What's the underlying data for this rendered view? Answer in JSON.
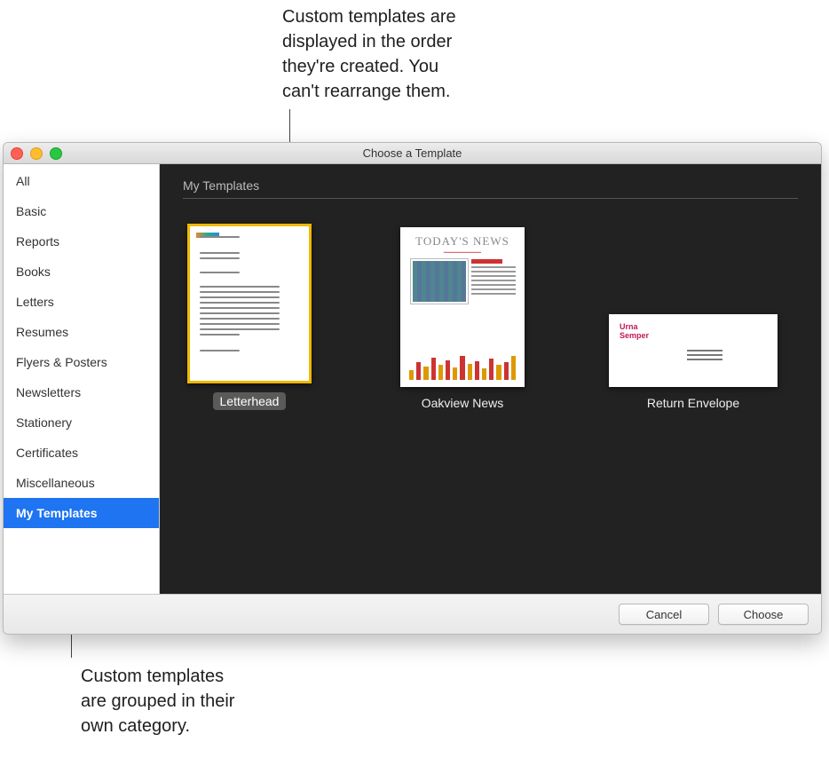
{
  "callouts": {
    "top": "Custom templates are\ndisplayed in the order\nthey're created. You\ncan't rearrange them.",
    "bottom": "Custom templates\nare grouped in their\nown category."
  },
  "window": {
    "title": "Choose a Template"
  },
  "sidebar": {
    "items": [
      {
        "label": "All",
        "selected": false
      },
      {
        "label": "Basic",
        "selected": false
      },
      {
        "label": "Reports",
        "selected": false
      },
      {
        "label": "Books",
        "selected": false
      },
      {
        "label": "Letters",
        "selected": false
      },
      {
        "label": "Resumes",
        "selected": false
      },
      {
        "label": "Flyers & Posters",
        "selected": false
      },
      {
        "label": "Newsletters",
        "selected": false
      },
      {
        "label": "Stationery",
        "selected": false
      },
      {
        "label": "Certificates",
        "selected": false
      },
      {
        "label": "Miscellaneous",
        "selected": false
      },
      {
        "label": "My Templates",
        "selected": true
      }
    ]
  },
  "content": {
    "section_title": "My Templates",
    "templates": [
      {
        "label": "Letterhead",
        "kind": "letter",
        "selected": true
      },
      {
        "label": "Oakview News",
        "kind": "news",
        "selected": false
      },
      {
        "label": "Return Envelope",
        "kind": "envelope",
        "selected": false
      }
    ],
    "news_headline": "TODAY'S NEWS",
    "env_name1": "Urna",
    "env_name2": "Semper"
  },
  "footer": {
    "cancel": "Cancel",
    "choose": "Choose"
  }
}
